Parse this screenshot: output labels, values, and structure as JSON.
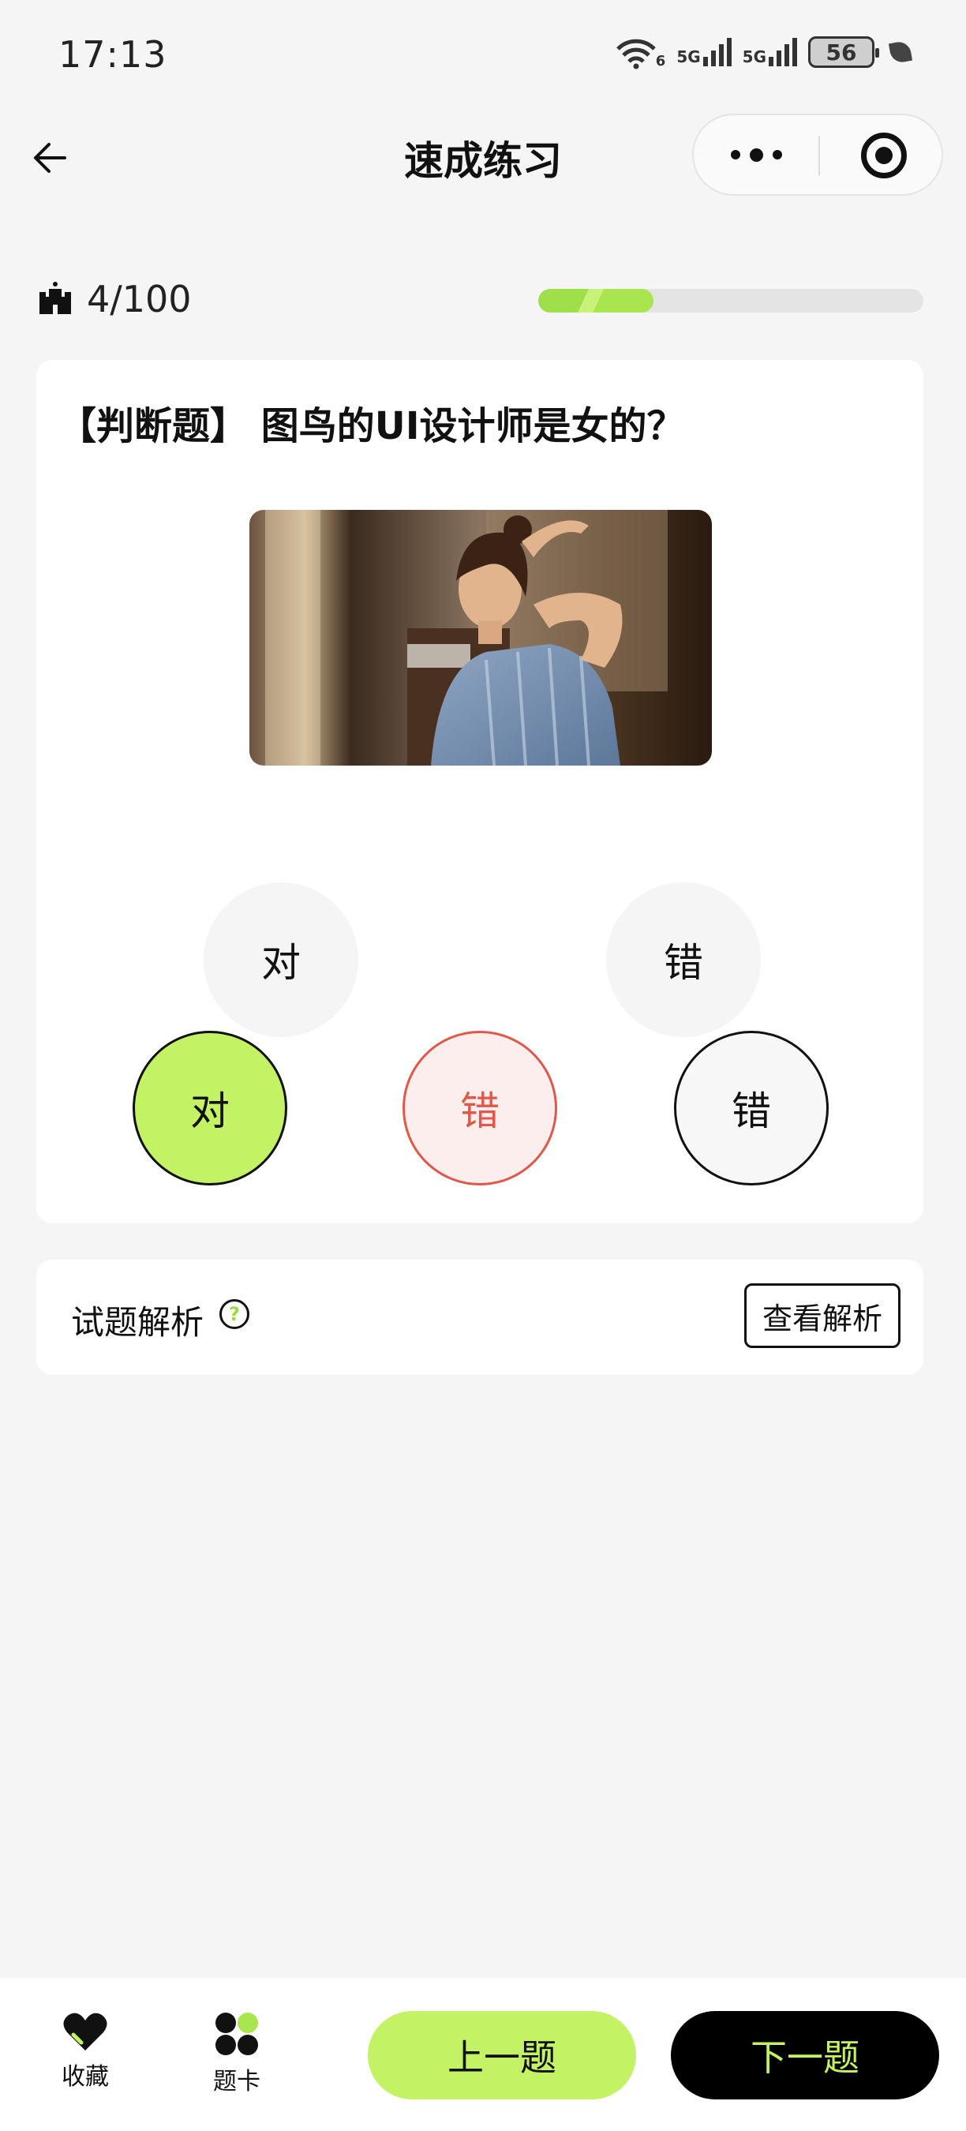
{
  "status_bar": {
    "time": "17:13",
    "wifi_label": "6",
    "signal1_label": "5G",
    "signal2_label": "5G",
    "battery": "56"
  },
  "nav": {
    "title": "速成练习",
    "back_icon": "arrow-left-icon",
    "more_icon": "more-dots-icon",
    "close_icon": "target-icon"
  },
  "progress": {
    "count": "4/100",
    "current": 4,
    "total": 100,
    "fill_fraction": 0.3,
    "icon": "castle-icon",
    "accent": "#9fe04a"
  },
  "question": {
    "text": "【判断题】 图鸟的UI设计师是女的？",
    "image": "portrait-photo",
    "options_row1": [
      "对",
      "错"
    ],
    "options_row2": [
      "对",
      "错",
      "错"
    ]
  },
  "analysis": {
    "label": "试题解析",
    "help_icon": "question-circle-icon",
    "button": "查看解析"
  },
  "bottom_bar": {
    "favorite": "收藏",
    "favorite_icon": "heart-icon",
    "card": "题卡",
    "card_icon": "clover-grid-icon",
    "prev": "上一题",
    "next": "下一题"
  },
  "colors": {
    "accent_green": "#c3f264",
    "wrong_red": "#e0584a",
    "background": "#f5f5f5"
  }
}
